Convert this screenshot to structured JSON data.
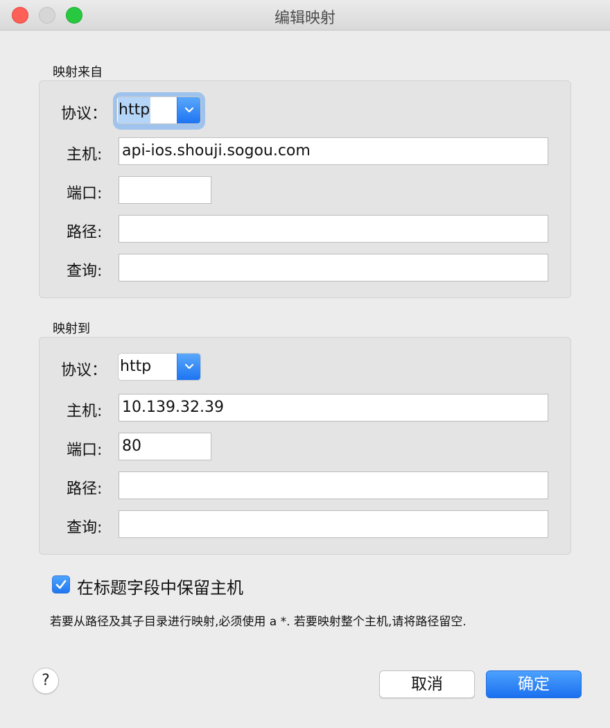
{
  "window": {
    "title": "编辑映射"
  },
  "from": {
    "section_label": "映射来自",
    "protocol_label": "协议：",
    "protocol_value": "http",
    "host_label": "主机:",
    "host_value": "api-ios.shouji.sogou.com",
    "port_label": "端口:",
    "port_value": "",
    "path_label": "路径:",
    "path_value": "",
    "query_label": "查询:",
    "query_value": ""
  },
  "to": {
    "section_label": "映射到",
    "protocol_label": "协议：",
    "protocol_value": "http",
    "host_label": "主机:",
    "host_value": "10.139.32.39",
    "port_label": "端口:",
    "port_value": "80",
    "path_label": "路径:",
    "path_value": "",
    "query_label": "查询:",
    "query_value": ""
  },
  "options": {
    "preserve_host_label": "在标题字段中保留主机",
    "preserve_host_checked": true,
    "hint": "若要从路径及其子目录进行映射,必须使用 a *. 若要映射整个主机,请将路径留空."
  },
  "buttons": {
    "help": "?",
    "cancel": "取消",
    "ok": "确定"
  },
  "colors": {
    "accent": "#1d74f2",
    "focus_ring": "#9fc3ec"
  }
}
